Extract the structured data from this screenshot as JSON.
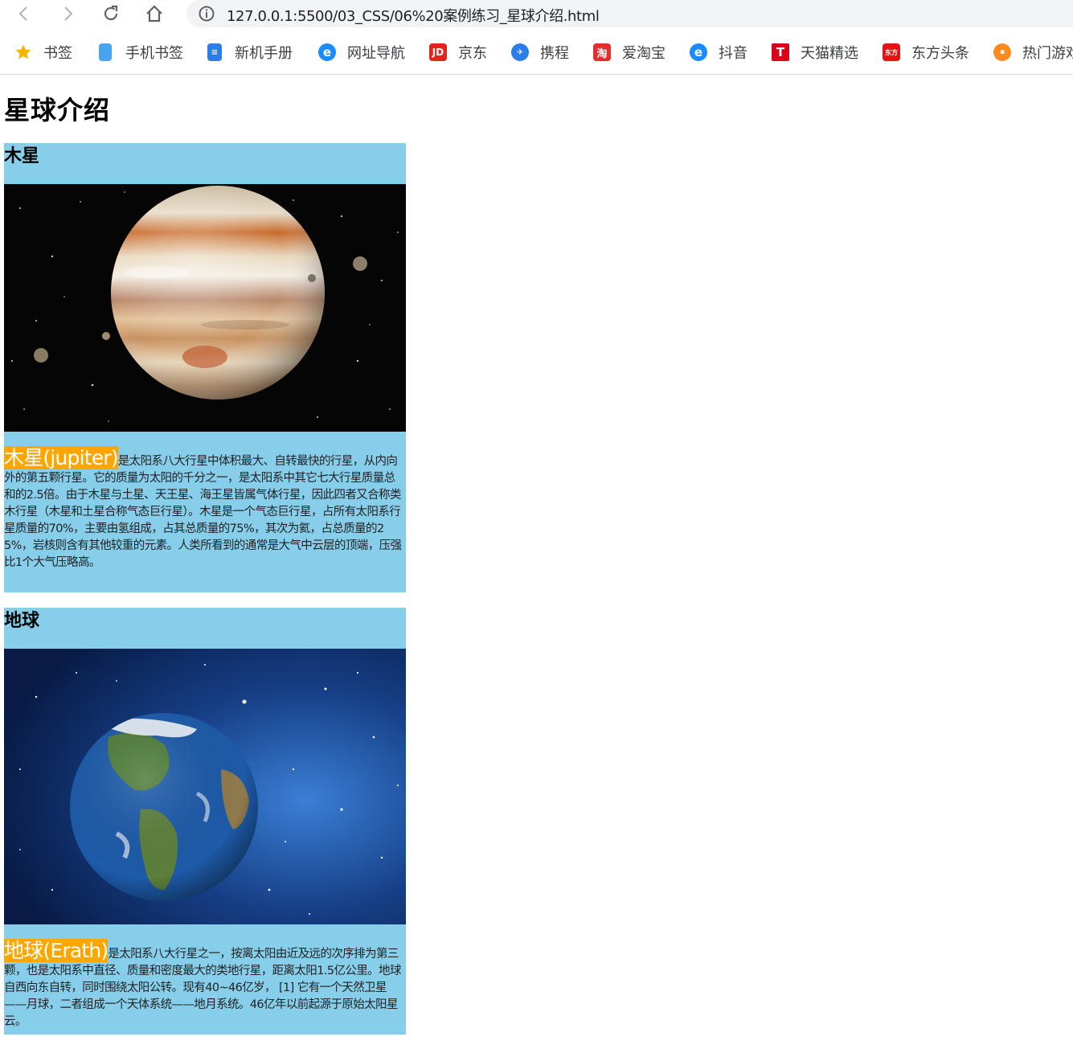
{
  "browser": {
    "url": "127.0.0.1:5500/03_CSS/06%20案例练习_星球介绍.html",
    "bookmarks": [
      {
        "label": "书签",
        "icon": "star-icon",
        "color": "#f5b400"
      },
      {
        "label": "手机书签",
        "icon": "phone-icon",
        "color": "#4aa3f0"
      },
      {
        "label": "新机手册",
        "icon": "manual-icon",
        "color": "#2b7de9"
      },
      {
        "label": "网址导航",
        "icon": "ie-icon",
        "color": "#1a8cff"
      },
      {
        "label": "京东",
        "icon": "jd-icon",
        "color": "#e1251b"
      },
      {
        "label": "携程",
        "icon": "ctrip-icon",
        "color": "#2b7de9"
      },
      {
        "label": "爱淘宝",
        "icon": "taobao-icon",
        "color": "#e42d2d"
      },
      {
        "label": "抖音",
        "icon": "ie-icon",
        "color": "#1a8cff"
      },
      {
        "label": "天猫精选",
        "icon": "tmall-icon",
        "color": "#d8001a"
      },
      {
        "label": "东方头条",
        "icon": "dongfang-icon",
        "color": "#e41414"
      },
      {
        "label": "热门游戏",
        "icon": "game-icon",
        "color": "#ff8a1e"
      }
    ]
  },
  "page": {
    "title": "星球介绍",
    "planets": [
      {
        "name": "木星",
        "image": "jupiter-image",
        "tag": "木星(jupiter)",
        "text": "是太阳系八大行星中体积最大、自转最快的行星，从内向外的第五颗行星。它的质量为太阳的千分之一，是太阳系中其它七大行星质量总和的2.5倍。由于木星与土星、天王星、海王星皆属气体行星，因此四者又合称类木行星（木星和土星合称气态巨行星）。木星是一个气态巨行星，占所有太阳系行星质量的70%，主要由氢组成，占其总质量的75%，其次为氦，占总质量的25%，岩核则含有其他较重的元素。人类所看到的通常是大气中云层的顶端，压强比1个大气压略高。"
      },
      {
        "name": "地球",
        "image": "earth-image",
        "tag": "地球(Erath)",
        "text": "是太阳系八大行星之一，按离太阳由近及远的次序排为第三颗，也是太阳系中直径、质量和密度最大的类地行星，距离太阳1.5亿公里。地球自西向东自转，同时围绕太阳公转。现有40~46亿岁， [1] 它有一个天然卫星——月球，二者组成一个天体系统——地月系统。46亿年以前起源于原始太阳星云。"
      }
    ]
  },
  "colors": {
    "card_bg": "#87ceeb",
    "tag_bg": "#ffa500",
    "tag_text": "#ffffff"
  }
}
